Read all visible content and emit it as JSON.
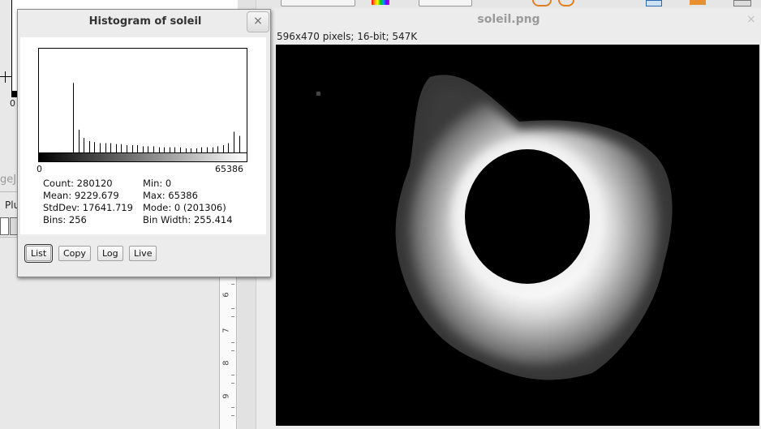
{
  "background": {
    "zero_label": "0",
    "strip_text": "geJ",
    "plugins_label": "Plu",
    "ruler_numbers": [
      "6",
      "7",
      "8",
      "9"
    ]
  },
  "image_window": {
    "title": "soleil.png",
    "close_glyph": "×",
    "info": "596x470 pixels; 16-bit; 547K",
    "toolbar_icons": [
      "color-picker-icon",
      "undo-icon",
      "redo-icon",
      "export-icon",
      "open-folder-icon",
      "save-icon"
    ]
  },
  "histogram_dialog": {
    "title": "Histogram of soleil",
    "close_glyph": "×",
    "x_min": "0",
    "x_max": "65386",
    "stats": {
      "count": "Count: 280120",
      "mean": "Mean: 9229.679",
      "stddev": "StdDev: 17641.719",
      "bins": "Bins: 256",
      "min": "Min: 0",
      "max": "Max: 65386",
      "mode": "Mode: 0 (201306)",
      "bin_width": "Bin Width: 255.414"
    },
    "buttons": {
      "list": "List",
      "copy": "Copy",
      "log": "Log",
      "live": "Live"
    },
    "bar_heights": [
      0.67,
      0.22,
      0.14,
      0.11,
      0.1,
      0.09,
      0.09,
      0.09,
      0.08,
      0.08,
      0.07,
      0.07,
      0.07,
      0.06,
      0.06,
      0.06,
      0.05,
      0.05,
      0.05,
      0.05,
      0.05,
      0.04,
      0.04,
      0.04,
      0.05,
      0.05,
      0.05,
      0.06,
      0.07,
      0.09,
      0.2,
      0.16
    ]
  }
}
